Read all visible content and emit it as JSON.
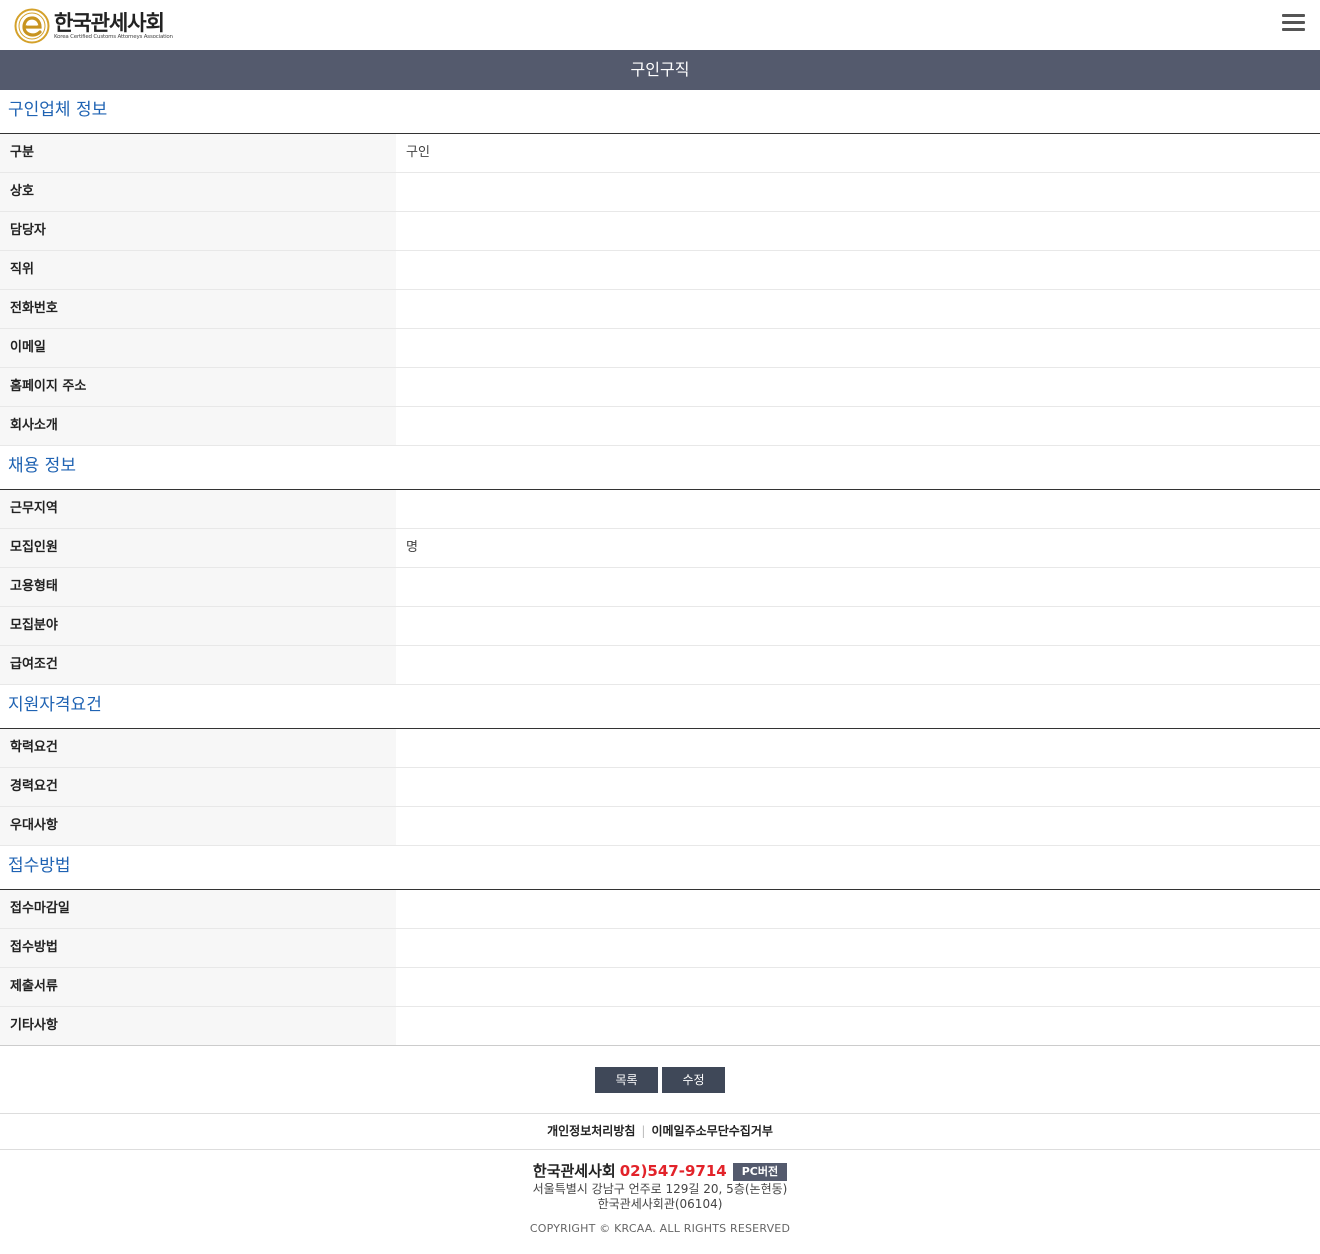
{
  "header": {
    "logo_title": "한국관세사회",
    "logo_subtitle": "Korea Certified Customs Attorneys Association",
    "logo_colors": {
      "ring": "#d4a12a",
      "center": "#c89420"
    }
  },
  "title_bar": "구인구직",
  "sections": [
    {
      "title": "구인업체 정보",
      "rows": [
        {
          "label": "구분",
          "value": "구인"
        },
        {
          "label": "상호",
          "value": ""
        },
        {
          "label": "담당자",
          "value": ""
        },
        {
          "label": "직위",
          "value": ""
        },
        {
          "label": "전화번호",
          "value": ""
        },
        {
          "label": "이메일",
          "value": ""
        },
        {
          "label": "홈페이지 주소",
          "value": ""
        },
        {
          "label": "회사소개",
          "value": ""
        }
      ]
    },
    {
      "title": "채용 정보",
      "rows": [
        {
          "label": "근무지역",
          "value": ""
        },
        {
          "label": "모집인원",
          "value": "명"
        },
        {
          "label": "고용형태",
          "value": ""
        },
        {
          "label": "모집분야",
          "value": ""
        },
        {
          "label": "급여조건",
          "value": ""
        }
      ]
    },
    {
      "title": "지원자격요건",
      "rows": [
        {
          "label": "학력요건",
          "value": ""
        },
        {
          "label": "경력요건",
          "value": ""
        },
        {
          "label": "우대사항",
          "value": ""
        }
      ]
    },
    {
      "title": "접수방법",
      "rows": [
        {
          "label": "접수마감일",
          "value": ""
        },
        {
          "label": "접수방법",
          "value": ""
        },
        {
          "label": "제출서류",
          "value": ""
        },
        {
          "label": "기타사항",
          "value": ""
        }
      ]
    }
  ],
  "buttons": {
    "list": "목록",
    "edit": "수정"
  },
  "footer": {
    "links": [
      "개인정보처리방침",
      "이메일주소무단수집거부"
    ],
    "org_name": "한국관세사회",
    "phone": "02)547-9714",
    "pc_version": "PC버전",
    "address_line1": "서울특별시 강남구 언주로 129길 20, 5층(논현동)",
    "address_line2": "한국관세사회관(06104)",
    "copyright": "COPYRIGHT © KRCAA. ALL RIGHTS RESERVED"
  },
  "colors": {
    "title_bar_bg": "#545a6d",
    "section_title": "#1f63b3",
    "phone": "#e2232a",
    "button_bg": "#3f4858"
  }
}
